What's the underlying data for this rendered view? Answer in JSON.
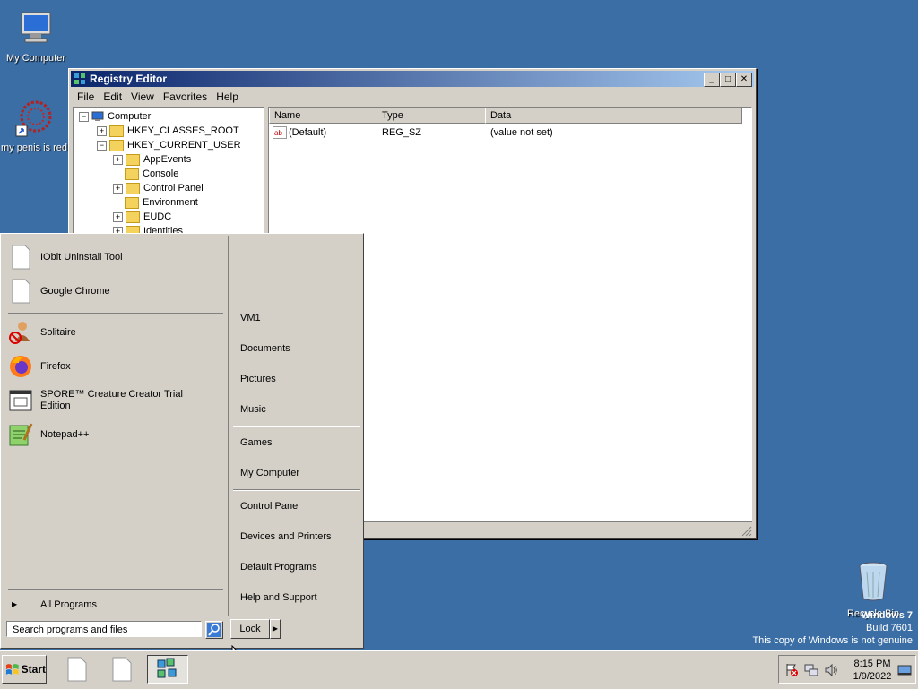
{
  "desktop": {
    "icons": [
      {
        "label": "My Computer"
      },
      {
        "label": "my penis is red"
      },
      {
        "label": "Recycle Bin"
      }
    ],
    "watermark": {
      "line1": "Windows 7",
      "line2": "Build 7601",
      "line3": "This copy of Windows is not genuine"
    }
  },
  "regedit": {
    "title": "Registry Editor",
    "menu": [
      "File",
      "Edit",
      "View",
      "Favorites",
      "Help"
    ],
    "tree": [
      {
        "label": "Computer",
        "toggle": "−"
      },
      {
        "label": "HKEY_CLASSES_ROOT",
        "toggle": "+"
      },
      {
        "label": "HKEY_CURRENT_USER",
        "toggle": "−"
      },
      {
        "label": "AppEvents",
        "toggle": "+"
      },
      {
        "label": "Console",
        "toggle": ""
      },
      {
        "label": "Control Panel",
        "toggle": "+"
      },
      {
        "label": "Environment",
        "toggle": ""
      },
      {
        "label": "EUDC",
        "toggle": "+"
      },
      {
        "label": "Identities",
        "toggle": "+"
      }
    ],
    "columns": [
      "Name",
      "Type",
      "Data"
    ],
    "rows": [
      {
        "name": "(Default)",
        "type": "REG_SZ",
        "data": "(value not set)"
      }
    ]
  },
  "startmenu": {
    "pinned": [
      {
        "label": "IObit Uninstall Tool"
      },
      {
        "label": "Google Chrome"
      }
    ],
    "recent": [
      {
        "label": "Solitaire"
      },
      {
        "label": "Firefox"
      },
      {
        "label": "SPORE™ Creature Creator Trial Edition"
      },
      {
        "label": "Notepad++"
      }
    ],
    "all_programs": "All Programs",
    "search_placeholder": "Search programs and files",
    "right_items": [
      "VM1",
      "Documents",
      "Pictures",
      "Music",
      "Games",
      "My Computer",
      "Control Panel",
      "Devices and Printers",
      "Default Programs",
      "Help and Support"
    ],
    "lock_label": "Lock"
  },
  "taskbar": {
    "start_label": "Start",
    "time": "8:15 PM",
    "date": "1/9/2022"
  }
}
